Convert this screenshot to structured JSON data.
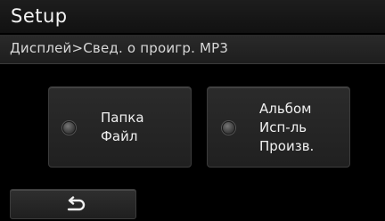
{
  "header": {
    "title": "Setup"
  },
  "breadcrumb": {
    "text": "Дисплей>Свед. о проигр. MP3"
  },
  "options": [
    {
      "lines": [
        "Папка",
        "Файл"
      ],
      "selected": false
    },
    {
      "lines": [
        "Альбом",
        "Исп-ль",
        "Произв."
      ],
      "selected": false
    }
  ],
  "footer": {
    "back_icon": "back-arrow-icon"
  }
}
